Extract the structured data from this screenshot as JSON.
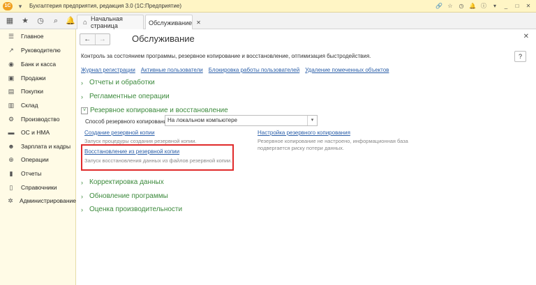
{
  "window": {
    "title": "Бухгалтерия предприятия, редакция 3.0  (1С:Предприятие)",
    "logo": "1С"
  },
  "tabs": [
    {
      "label": "Начальная страница"
    },
    {
      "label": "Обслуживание"
    }
  ],
  "sidebar": {
    "items": [
      {
        "label": "Главное",
        "icon": "menu-icon"
      },
      {
        "label": "Руководителю",
        "icon": "chart-icon"
      },
      {
        "label": "Банк и касса",
        "icon": "bank-icon"
      },
      {
        "label": "Продажи",
        "icon": "cart-icon"
      },
      {
        "label": "Покупки",
        "icon": "basket-icon"
      },
      {
        "label": "Склад",
        "icon": "warehouse-icon"
      },
      {
        "label": "Производство",
        "icon": "factory-icon"
      },
      {
        "label": "ОС и НМА",
        "icon": "truck-icon"
      },
      {
        "label": "Зарплата и кадры",
        "icon": "people-icon"
      },
      {
        "label": "Операции",
        "icon": "operations-icon"
      },
      {
        "label": "Отчеты",
        "icon": "reports-icon"
      },
      {
        "label": "Справочники",
        "icon": "book-icon"
      },
      {
        "label": "Администрирование",
        "icon": "gear-icon"
      }
    ]
  },
  "main": {
    "title": "Обслуживание",
    "description": "Контроль за состоянием программы, резервное копирование и восстановление, оптимизация быстродействия.",
    "help": "?",
    "links": [
      "Журнал регистрации",
      "Активные пользователи",
      "Блокировка работы пользователей",
      "Удаление помеченных объектов"
    ],
    "sections": {
      "reports": "Отчеты и обработки",
      "scheduled": "Регламентные операции",
      "backup": "Резервное копирование и восстановление",
      "correction": "Корректировка данных",
      "update": "Обновление программы",
      "performance": "Оценка производительности"
    },
    "backup": {
      "method_label": "Способ резервного копирования:",
      "method_value": "На локальном компьютере",
      "create_link": "Создание резервной копии",
      "create_note": "Запуск процедуры создания резервной копии.",
      "restore_link": "Восстановление из резервной копии",
      "restore_note": "Запуск восстановления данных из файлов резервной копии.",
      "settings_link": "Настройка резервного копирования",
      "settings_note_1": "Резервное копирование не настроено, информационная база",
      "settings_note_2": "подвергается риску потери данных."
    }
  },
  "colors": {
    "section_green": "#3c8a3c",
    "link_blue": "#2a5ea8",
    "highlight_red": "#e02a2a",
    "sidebar_bg": "#fffbe6",
    "titlebar_bg": "#fff5c5"
  }
}
